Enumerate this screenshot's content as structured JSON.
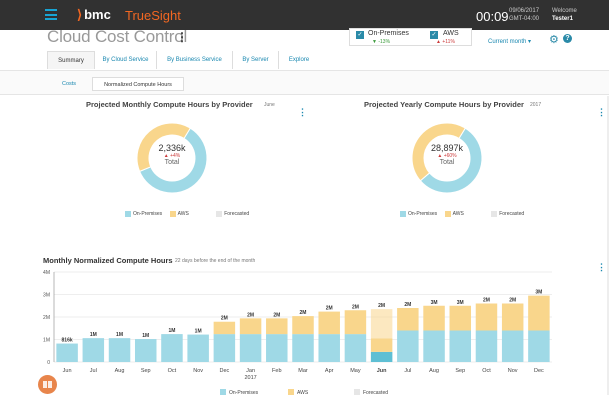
{
  "topbar": {
    "brand": "bmc",
    "product": "TrueSight",
    "time": "00:09",
    "date_line1": "09/06/2017",
    "date_line2": "GMT-04:00",
    "welcome": "Welcome",
    "user": "Tester1"
  },
  "page": {
    "title": "Cloud Cost Control",
    "kebab": "⋮"
  },
  "filters": {
    "onprem": {
      "label": "On-Premises",
      "change": "▼ -13%"
    },
    "aws": {
      "label": "AWS",
      "change": "▲ +11%"
    },
    "period": "Current month ▾"
  },
  "tabs": [
    "Summary",
    "By Cloud Service",
    "By Business Service",
    "By Server",
    "Explore"
  ],
  "subtabs": [
    "Costs",
    "Normalized Compute Hours"
  ],
  "colors": {
    "onprem": "#9fd9e6",
    "aws": "#f9d68c",
    "forecast": "#e6e6e6",
    "onprem_dark": "#5ebfd4"
  },
  "donut_monthly": {
    "title": "Projected Monthly Compute Hours by Provider",
    "subtitle": "June",
    "center_value": "2,336k",
    "center_change": "▲ +4%",
    "center_label": "Total"
  },
  "donut_yearly": {
    "title": "Projected Yearly Compute Hours by Provider",
    "subtitle": "2017",
    "center_value": "28,897k",
    "center_change": "▲ +60%",
    "center_label": "Total"
  },
  "legend": {
    "onprem": "On-Premises",
    "aws": "AWS",
    "forecast": "Forecasted"
  },
  "bar_chart": {
    "title": "Monthly Normalized Compute Hours",
    "subtitle": "22 days before the end of the month"
  },
  "chart_data": [
    {
      "type": "pie",
      "title": "Projected Monthly Compute Hours by Provider",
      "labels": [
        "On-Premises",
        "AWS"
      ],
      "values": [
        60,
        40
      ],
      "forecast_fraction": 0.05
    },
    {
      "type": "pie",
      "title": "Projected Yearly Compute Hours by Provider",
      "labels": [
        "On-Premises",
        "AWS"
      ],
      "values": [
        55,
        45
      ],
      "forecast_fraction": 0.04
    },
    {
      "type": "bar",
      "stacked": true,
      "title": "Monthly Normalized Compute Hours",
      "categories": [
        "Jun",
        "Jul",
        "Aug",
        "Sep",
        "Oct",
        "Nov",
        "Dec",
        "Jan",
        "Feb",
        "Mar",
        "Apr",
        "May",
        "Jun",
        "Jul",
        "Aug",
        "Sep",
        "Oct",
        "Nov",
        "Dec"
      ],
      "year_label": "2017",
      "year_label_index": 7,
      "bold_index": 12,
      "ylim": [
        0,
        4
      ],
      "yticks": [
        "0",
        "1M",
        "2M",
        "3M",
        "4M"
      ],
      "total_labels": [
        "816k",
        "1M",
        "1M",
        "1M",
        "1M",
        "1M",
        "2M",
        "2M",
        "2M",
        "2M",
        "2M",
        "2M",
        "2M",
        "2M",
        "3M",
        "3M",
        "2M",
        "2M",
        "3M"
      ],
      "series": [
        {
          "name": "On-Premises",
          "values": [
            0.82,
            1.06,
            1.06,
            1.02,
            1.24,
            1.22,
            1.24,
            1.24,
            1.24,
            1.24,
            1.24,
            1.24,
            0.45,
            1.4,
            1.4,
            1.4,
            1.4,
            1.4,
            1.4
          ]
        },
        {
          "name": "AWS",
          "values": [
            0,
            0,
            0,
            0,
            0,
            0,
            0.55,
            0.7,
            0.7,
            0.8,
            1.0,
            1.06,
            0.6,
            1.0,
            1.1,
            1.1,
            1.2,
            1.2,
            1.55
          ]
        },
        {
          "name": "Forecasted",
          "values": [
            0,
            0,
            0,
            0,
            0,
            0,
            0,
            0,
            0,
            0,
            0,
            0,
            1.3,
            0,
            0,
            0,
            0,
            0,
            0
          ]
        }
      ]
    }
  ]
}
